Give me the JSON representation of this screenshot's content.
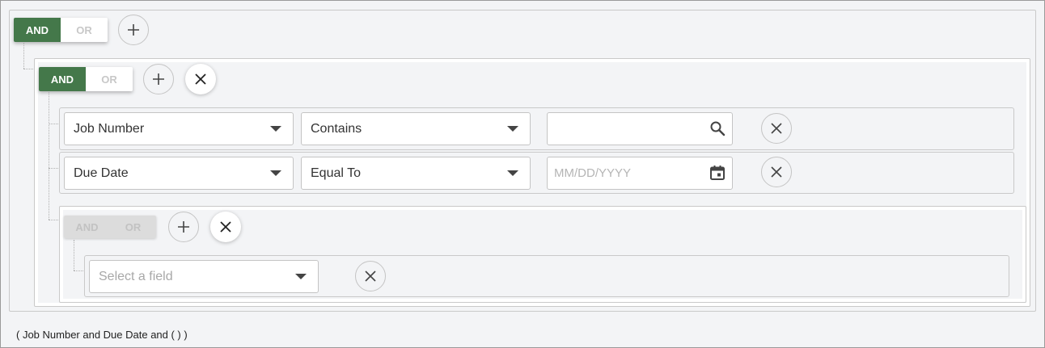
{
  "root_group": {
    "and_label": "AND",
    "or_label": "OR"
  },
  "group_1": {
    "and_label": "AND",
    "or_label": "OR",
    "rules": [
      {
        "field": "Job Number",
        "operator": "Contains",
        "value": "",
        "placeholder": "",
        "value_icon": "search-icon"
      },
      {
        "field": "Due Date",
        "operator": "Equal To",
        "value": "",
        "placeholder": "MM/DD/YYYY",
        "value_icon": "calendar-icon"
      }
    ]
  },
  "group_2": {
    "and_label": "AND",
    "or_label": "OR",
    "rules": [
      {
        "field_placeholder": "Select a field"
      }
    ]
  },
  "summary": "( Job Number and Due Date and ( ) )",
  "colors": {
    "accent": "#44784a",
    "background": "#f3f4f6",
    "border": "#c9c9c9"
  }
}
